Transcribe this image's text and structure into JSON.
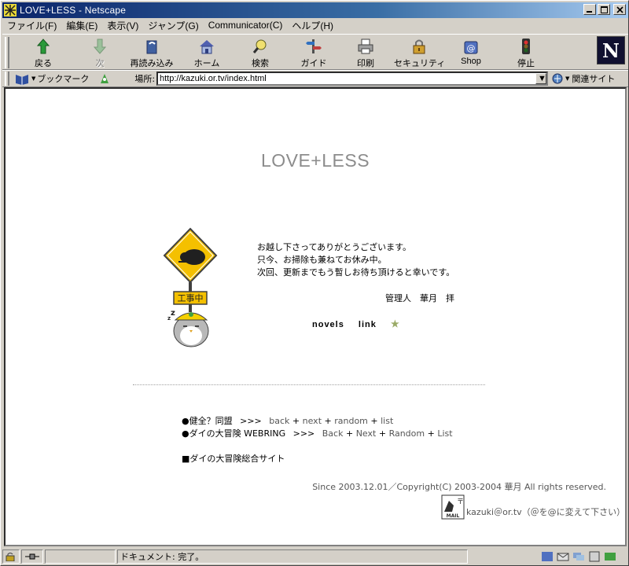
{
  "window": {
    "title": "LOVE+LESS - Netscape",
    "buttons": {
      "minimize": "_",
      "maximize": "□",
      "close": "×"
    }
  },
  "menu": [
    "ファイル(F)",
    "編集(E)",
    "表示(V)",
    "ジャンプ(G)",
    "Communicator(C)",
    "ヘルプ(H)"
  ],
  "toolbar": {
    "back": "戻る",
    "forward": "次",
    "reload": "再読み込み",
    "home": "ホーム",
    "search": "検索",
    "guide": "ガイド",
    "print": "印刷",
    "security": "セキュリティ",
    "shop": "Shop",
    "stop": "停止",
    "logo": "N"
  },
  "location": {
    "bookmarks": "ブックマーク",
    "label": "場所:",
    "url": "http://kazuki.or.tv/index.html",
    "related": "関連サイト"
  },
  "page": {
    "title": "LOVE+LESS",
    "sign_text": "工事中",
    "message": [
      "お越し下さってありがとうございます。",
      "只今、お掃除も兼ねてお休み中。",
      "次回、更新までもう暫しお待ち頂けると幸いです。"
    ],
    "signature": "管理人　華月　拝",
    "links": {
      "novels": "novels",
      "link": "link",
      "star": "★"
    },
    "webring1": {
      "bullet": "●健全？同盟",
      "sep": ">>>",
      "links": [
        "back",
        "next",
        "random",
        "list"
      ]
    },
    "webring2": {
      "bullet": "●ダイの大冒険 WEBRING",
      "sep": ">>>",
      "links": [
        "Back",
        "Next",
        "Random",
        "List"
      ]
    },
    "portal": "■ダイの大冒険総合サイト",
    "copyright": "Since  2003.12.01／Copyright(C) 2003-2004 華月 All rights reserved.",
    "mail_text": "kazuki＠or.tv（＠を@に変えて下さい）",
    "mail_overlay": "bg-icon-material-credits"
  },
  "status": {
    "text": "ドキュメント: 完了。"
  }
}
